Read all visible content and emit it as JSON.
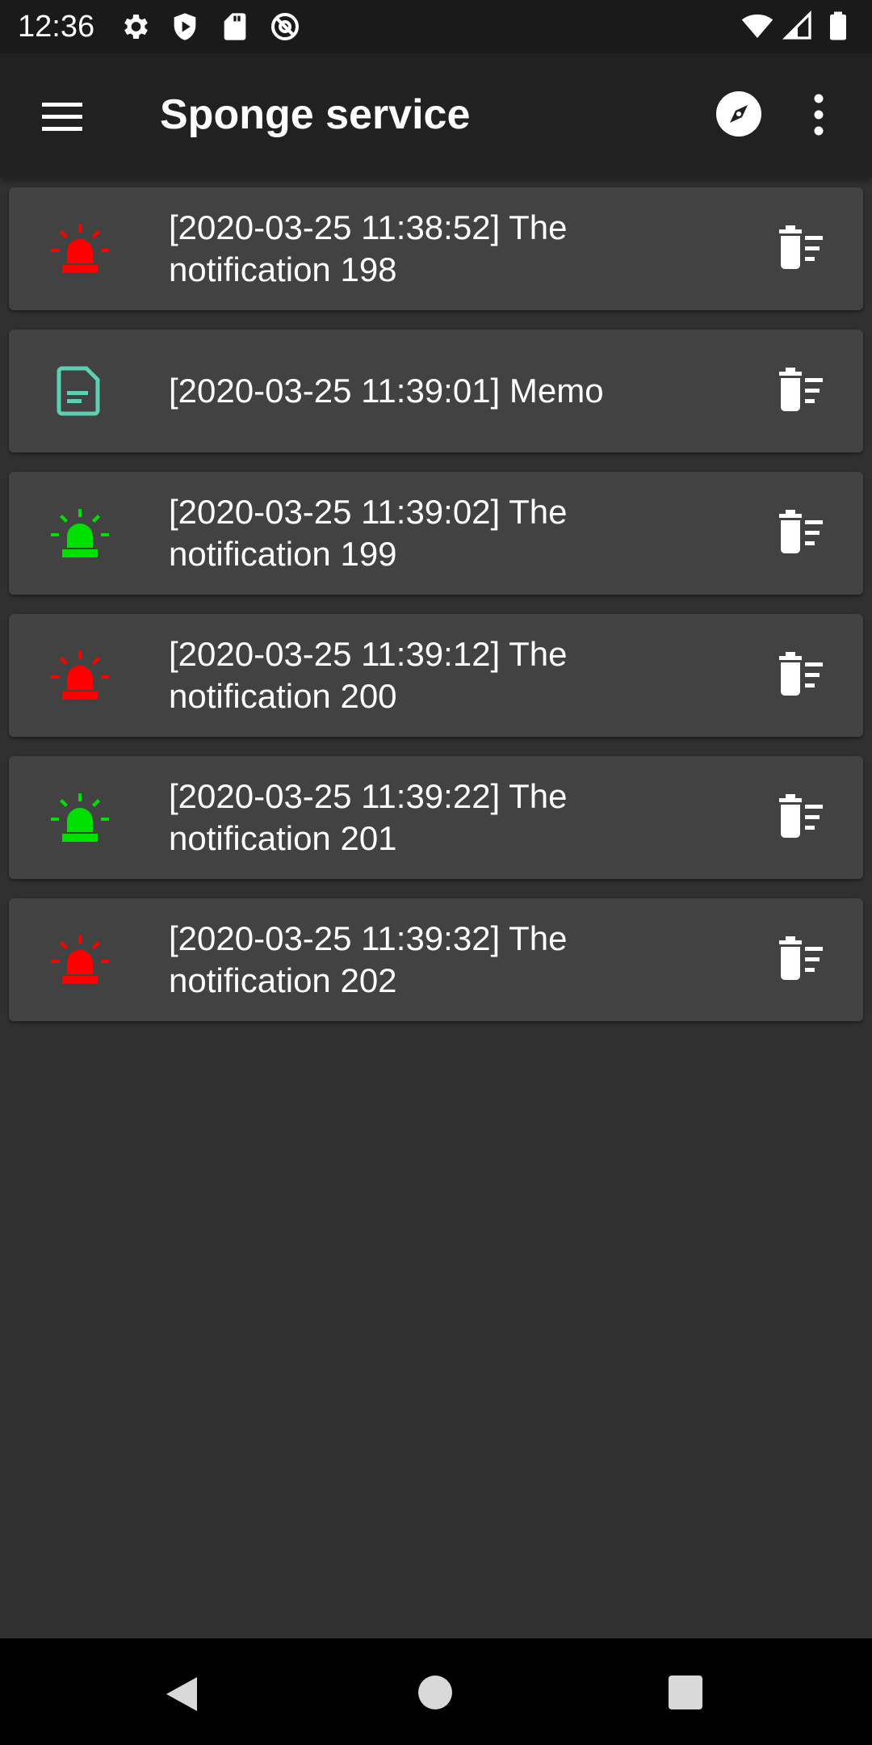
{
  "status_bar": {
    "time": "12:36",
    "left_icons": [
      "settings-icon",
      "shield-icon",
      "sd-card-icon",
      "at-sign-icon"
    ],
    "right_icons": [
      "wifi-icon",
      "signal-icon",
      "battery-icon"
    ]
  },
  "app_bar": {
    "title": "Sponge service",
    "menu_icon": "hamburger-menu-icon",
    "action_icon": "compass-icon",
    "overflow_icon": "more-vert-icon"
  },
  "colors": {
    "alarm_red": "#ff0000",
    "alarm_green": "#00e000",
    "memo_teal": "#5fcfb4",
    "card_bg": "#424242",
    "page_bg": "#303030"
  },
  "events": [
    {
      "icon": "red-alarm-light-icon",
      "text": "[2020-03-25 11:38:52]  The notification 198"
    },
    {
      "icon": "memo-document-icon",
      "text": "[2020-03-25 11:39:01]  Memo"
    },
    {
      "icon": "green-alarm-light-icon",
      "text": "[2020-03-25 11:39:02]  The notification 199"
    },
    {
      "icon": "red-alarm-light-icon",
      "text": "[2020-03-25 11:39:12]  The notification 200"
    },
    {
      "icon": "green-alarm-light-icon",
      "text": "[2020-03-25 11:39:22]  The notification 201"
    },
    {
      "icon": "red-alarm-light-icon",
      "text": "[2020-03-25 11:39:32]  The notification 202"
    }
  ],
  "nav_bar": {
    "back_icon": "nav-back-icon",
    "home_icon": "nav-home-icon",
    "recents_icon": "nav-recents-icon"
  }
}
